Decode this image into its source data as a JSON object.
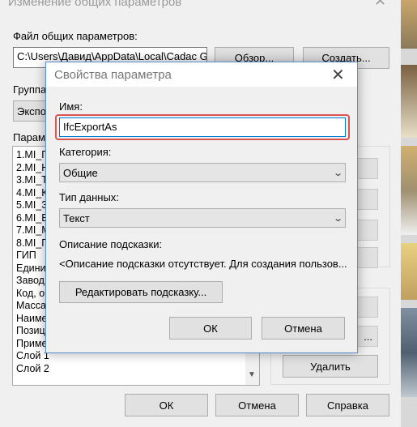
{
  "outer_dialog": {
    "title": "Изменение общих параметров",
    "file_label": "Файл общих параметров:",
    "file_path": "C:\\Users\\Давид\\AppData\\Local\\Cadac G",
    "browse_label": "Обзор...",
    "create_label": "Создать...",
    "group_label": "Группа",
    "group_value": "Экспор",
    "params_label": "Параме",
    "params": [
      "1.MI_П",
      "2.MI_Н",
      "3.MI_Т",
      "4.MI_К",
      "5.MI_З",
      "6.MI_Е",
      "7.MI_М",
      "8.MI_П",
      "ГИП",
      "Единиц",
      "Завод",
      "Код, о",
      "Масса",
      "Наиме",
      "Позици",
      "Приме",
      "Слой 1",
      "Слой 2"
    ],
    "right_button_partial": "...",
    "delete_label": "Удалить",
    "ok_label": "ОК",
    "cancel_label": "Отмена",
    "help_label": "Справка"
  },
  "param_dialog": {
    "title": "Свойства параметра",
    "name_label": "Имя:",
    "name_value": "IfcExportAs",
    "category_label": "Категория:",
    "category_value": "Общие",
    "datatype_label": "Тип данных:",
    "datatype_value": "Текст",
    "tooltip_label": "Описание подсказки:",
    "tooltip_value": "<Описание подсказки отсутствует. Для создания пользов...",
    "edit_tooltip_label": "Редактировать подсказку...",
    "ok_label": "ОК",
    "cancel_label": "Отмена"
  },
  "colors": {
    "highlight_border": "#d9534f",
    "focus_border": "#0078d7"
  }
}
